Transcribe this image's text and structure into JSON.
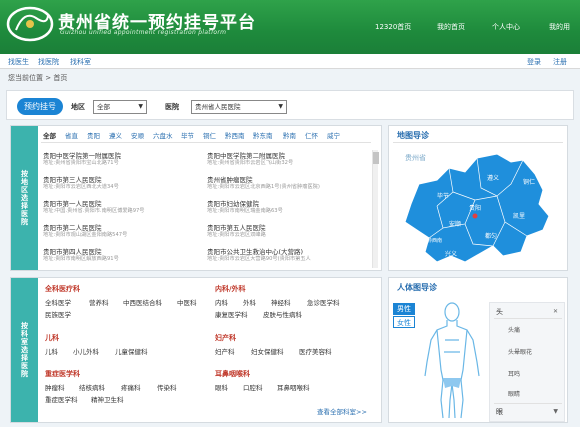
{
  "header": {
    "title": "贵州省统一预约挂号平台",
    "subtitle": "Guizhou unified appointment registration platform",
    "nav": [
      "12320首页",
      "我的首页",
      "个人中心",
      "我的用"
    ]
  },
  "subbar": {
    "links": [
      "找医生",
      "找医院",
      "找科室"
    ],
    "search": "登录",
    "logout": "注册"
  },
  "breadcrumb": "您当前位置 > 首页",
  "filter": {
    "button": "预约挂号",
    "region_label": "地区",
    "region_value": "全部",
    "hospital_label": "医院",
    "hospital_value": "贵州省人民医院"
  },
  "hospital_panel": {
    "side_label": "按地区选择医院",
    "tabs": [
      "全部",
      "省直",
      "贵阳",
      "遵义",
      "安顺",
      "六盘水",
      "毕节",
      "铜仁",
      "黔西南",
      "黔东南",
      "黔南",
      "仁怀",
      "威宁"
    ],
    "active_tab": "全部",
    "hospitals": [
      {
        "name": "贵阳中医学院第一附属医院",
        "addr": "地址:贵州省贵阳市宝山北路71号"
      },
      {
        "name": "贵阳中医学院第二附属医院",
        "addr": "地址:贵州省贵阳市云岩区飞山街32号"
      },
      {
        "name": "贵阳市第三人民医院",
        "addr": "地址:贵阳市云岩区西北大道34号"
      },
      {
        "name": "贵州省肿瘤医院",
        "addr": "地址:贵阳市云岩区北京西路1号(贵州省肿瘤医院)"
      },
      {
        "name": "贵阳市第一人民医院",
        "addr": "地址:中国.贵州省.贵阳市.南明区博爱路97号"
      },
      {
        "name": "贵阳市妇幼保健院",
        "addr": "地址:贵阳市南明区瑞金南路63号"
      },
      {
        "name": "贵阳市第二人民医院",
        "addr": "地址:贵阳市观山湖区金阳南路547号"
      },
      {
        "name": "贵阳市第五人民医院",
        "addr": "地址:贵阳市云岩区双峰路"
      },
      {
        "name": "贵阳市第四人民医院",
        "addr": "地址:贵阳市南明区解放西路91号"
      },
      {
        "name": "贵阳市公共卫生救治中心(大营路)",
        "addr": "地址:贵阳市云岩区大营路90号(贵阳市第五人"
      }
    ]
  },
  "map_panel": {
    "title": "地图导诊",
    "province": "贵州省",
    "cities": [
      "遵义",
      "铜仁",
      "毕节",
      "贵阳",
      "安顺",
      "凯里",
      "黔西南",
      "都匀",
      "兴义"
    ]
  },
  "dept_panel": {
    "side_label": "按科室选择医院",
    "groups": [
      {
        "title": "全科医疗科",
        "items": [
          "全科医学",
          "营养科",
          "中西医结合科",
          "中医科",
          "民族医学"
        ]
      },
      {
        "title": "内科/外科",
        "items": [
          "内科",
          "外科",
          "神经科",
          "急诊医学科",
          "康复医学科",
          "皮肤与性病科"
        ]
      },
      {
        "title": "儿科",
        "items": [
          "儿科",
          "小儿外科",
          "儿童保健科"
        ]
      },
      {
        "title": "妇产科",
        "items": [
          "妇产科",
          "妇女保健科",
          "医疗美容科"
        ]
      },
      {
        "title": "重症医学科",
        "items": [
          "肿瘤科",
          "结核病科",
          "疼痛科",
          "传染科",
          "重症医学科",
          "精神卫生科"
        ]
      },
      {
        "title": "耳鼻咽喉科",
        "items": [
          "眼科",
          "口腔科",
          "耳鼻咽喉科"
        ]
      }
    ],
    "more": "查看全部科室>>"
  },
  "body_panel": {
    "title": "人体图导诊",
    "male": "男性",
    "female": "女性",
    "list_head": "头",
    "list_items": [
      "头痛",
      "头晕眼花",
      "耳鸣",
      "眼睛"
    ],
    "next_head": "眼"
  },
  "colors": {
    "header_green": "#1e8a3c",
    "accent_blue": "#1b84d4",
    "teal": "#3cb3ad",
    "map_blue": "#1f8fdc"
  }
}
